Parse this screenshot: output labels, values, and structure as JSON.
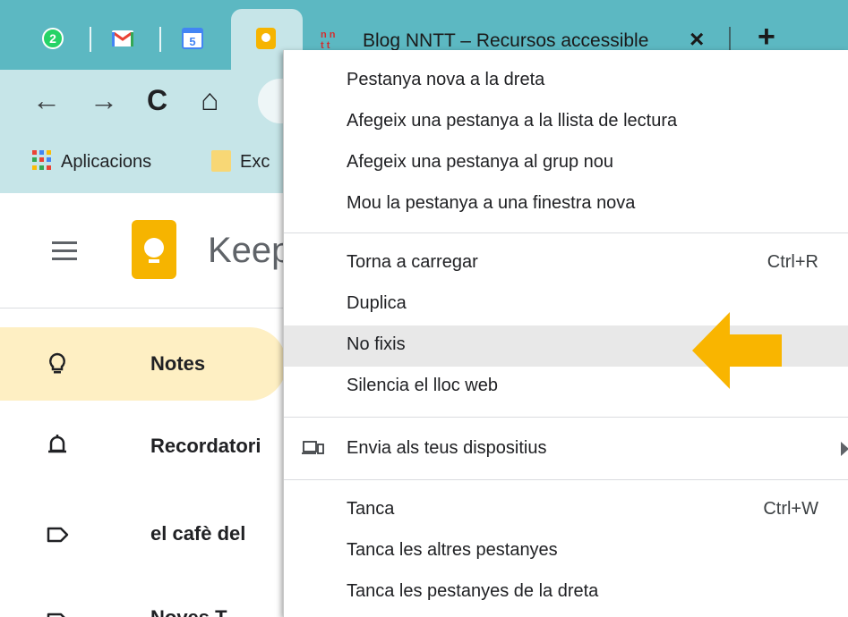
{
  "browser": {
    "tabs": [
      {
        "icon": "whatsapp-icon",
        "badge": "2"
      },
      {
        "icon": "gmail-icon",
        "label": "M"
      },
      {
        "icon": "calendar-icon",
        "label": "5"
      },
      {
        "icon": "keep-icon",
        "active": true
      },
      {
        "icon": "nntt-icon",
        "title": "Blog NNTT – Recursos accessible"
      }
    ],
    "new_tab": "+",
    "close_tab": "×",
    "nav": {
      "back": "←",
      "forward": "→",
      "reload": "C",
      "home": "⌂"
    },
    "bookmarks": [
      {
        "icon": "apps-grid-icon",
        "label": "Aplicacions"
      },
      {
        "icon": "folder-icon",
        "label": "Exc"
      }
    ]
  },
  "app": {
    "title": "Keep",
    "nav_items": [
      {
        "icon": "lightbulb-icon",
        "label": "Notes",
        "active": true
      },
      {
        "icon": "bell-icon",
        "label": "Recordatori"
      },
      {
        "icon": "label-icon",
        "label": "el cafè del"
      },
      {
        "icon": "label-icon",
        "label": "Noves T"
      }
    ]
  },
  "context_menu": {
    "groups": [
      [
        {
          "label": "Pestanya nova a la dreta"
        },
        {
          "label": "Afegeix una pestanya a la llista de lectura"
        },
        {
          "label": "Afegeix una pestanya al grup nou"
        },
        {
          "label": "Mou la pestanya a una finestra nova"
        }
      ],
      [
        {
          "label": "Torna a carregar",
          "shortcut": "Ctrl+R"
        },
        {
          "label": "Duplica"
        },
        {
          "label": "No fixis",
          "highlighted": true
        },
        {
          "label": "Silencia el lloc web"
        }
      ],
      [
        {
          "label": "Envia als teus dispositius",
          "icon": "devices-icon",
          "submenu": true
        }
      ],
      [
        {
          "label": "Tanca",
          "shortcut": "Ctrl+W"
        },
        {
          "label": "Tanca les altres pestanyes"
        },
        {
          "label": "Tanca les pestanyes de la dreta"
        }
      ]
    ]
  },
  "colors": {
    "tabstrip": "#5cb8c2",
    "toolbar": "#c6e5e8",
    "keep_yellow": "#f6b400",
    "active_nav": "#feefc3",
    "arrow": "#f9b500",
    "menu_highlight": "#e8e8e8"
  }
}
